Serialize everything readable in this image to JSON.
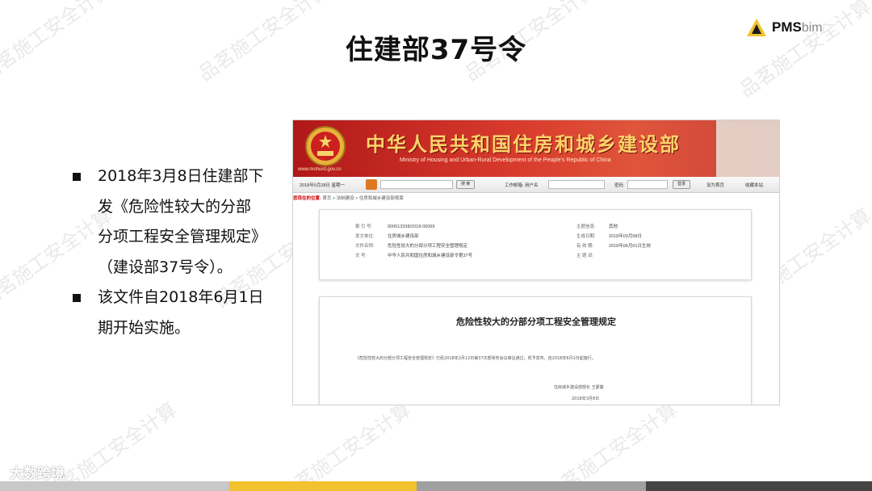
{
  "slide": {
    "title": "住建部37号令"
  },
  "logo": {
    "text_main": "PMS",
    "text_sub": "bim",
    "accent": "#f2c12e"
  },
  "bullets": [
    {
      "text": "2018年3月8日住建部下发《危险性较大的分部分项工程安全管理规定》（建设部37号令）。"
    },
    {
      "text": "该文件自2018年6月1日期开始实施。"
    }
  ],
  "web": {
    "site_url": "www.mohurd.gov.cn",
    "site_name": "中华人民共和国住房和城乡建设部",
    "site_name_en": "Ministry of Housing and Urban-Rural Development of the People's Republic of China",
    "toolbar": {
      "date": "2018年5月28日  星期一",
      "search_btn": "搜 索",
      "mail": "工作邮箱:  用户名",
      "password": "密码",
      "login_btn": "登录",
      "home": "设为首页",
      "fav": "收藏本站"
    },
    "breadcrumb_label": "您现在的位置:",
    "breadcrumb": "首页 > 法制建设 > 住房和城乡建设部规章",
    "meta": [
      {
        "k": "索 引 号:",
        "v": "000013338/2018-00069"
      },
      {
        "k": "发文单位:",
        "v": "住房城乡建设部"
      },
      {
        "k": "文件名称:",
        "v": "危险性较大的分部分项工程安全管理规定"
      },
      {
        "k": "文    号:",
        "v": "中华人民共和国住房和城乡建设部令第37号"
      }
    ],
    "meta_right": [
      {
        "k": "主题信息:",
        "v": "其他"
      },
      {
        "k": "生成日期:",
        "v": "2018年03月08日"
      },
      {
        "k": "有 效 期:",
        "v": "2018年06月01日生效"
      },
      {
        "k": "主 题 词:",
        "v": ""
      }
    ],
    "doc_title": "危险性较大的分部分项工程安全管理规定",
    "doc_body": "《危险性较大的分部分项工程安全管理规定》已经2018年2月12日第37次部常务会议审议通过，现予发布，自2018年6月1日起施行。",
    "doc_sign": "住房城乡建设部部长   王蒙徽",
    "doc_sign_date": "2018年3月8日"
  },
  "watermark": "品茗施工安全计算",
  "footer": {
    "credit": "大数跨境",
    "bar_colors": [
      "#c8c8c8",
      "#f2c12e",
      "#a0a0a0",
      "#444444"
    ]
  }
}
